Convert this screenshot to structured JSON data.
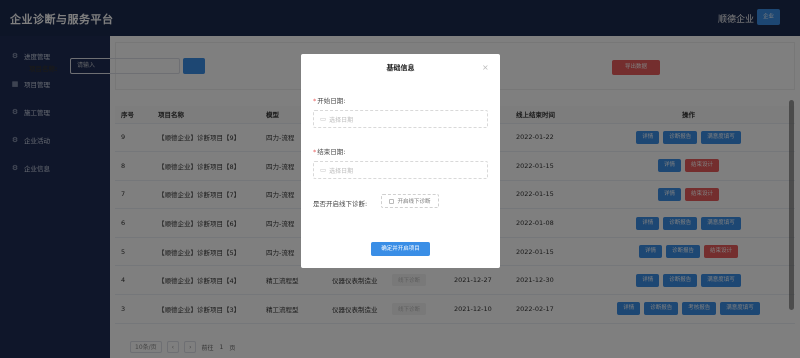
{
  "header": {
    "title": "企业诊断与服务平台",
    "company": "顺德企业",
    "role_badge": "企业"
  },
  "sidebar": {
    "items": [
      {
        "label": "进度管理",
        "icon": "gear-icon"
      },
      {
        "label": "项目管理",
        "icon": "grid-icon"
      },
      {
        "label": "施工管理",
        "icon": "gear-icon"
      },
      {
        "label": "企业活动",
        "icon": "gear-icon"
      },
      {
        "label": "企业信息",
        "icon": "gear-icon"
      }
    ]
  },
  "filter": {
    "label": "项目名称:",
    "placeholder": "请输入",
    "export_label": "导出数据"
  },
  "table": {
    "headers": [
      "序号",
      "项目名称",
      "模型",
      "",
      "",
      "",
      "线上结束时间",
      "操作"
    ],
    "rows": [
      {
        "no": "9",
        "name": "【顺德企业】诊断项目【9】",
        "model": "四力-流程",
        "industry": "",
        "status": "",
        "start": "",
        "end": "2022-01-22",
        "ops": [
          {
            "label": "详情",
            "color": "blue"
          },
          {
            "label": "诊断报告",
            "color": "blue"
          },
          {
            "label": "满意度填写",
            "color": "blue"
          }
        ]
      },
      {
        "no": "8",
        "name": "【顺德企业】诊断项目【8】",
        "model": "四力-流程",
        "industry": "",
        "status": "",
        "start": "",
        "end": "2022-01-15",
        "ops": [
          {
            "label": "详情",
            "color": "blue"
          },
          {
            "label": "结束设计",
            "color": "red"
          }
        ]
      },
      {
        "no": "7",
        "name": "【顺德企业】诊断项目【7】",
        "model": "四力-流程",
        "industry": "",
        "status": "",
        "start": "",
        "end": "2022-01-15",
        "ops": [
          {
            "label": "详情",
            "color": "blue"
          },
          {
            "label": "结束设计",
            "color": "red"
          }
        ]
      },
      {
        "no": "6",
        "name": "【顺德企业】诊断项目【6】",
        "model": "四力-流程",
        "industry": "",
        "status": "",
        "start": "",
        "end": "2022-01-08",
        "ops": [
          {
            "label": "详情",
            "color": "blue"
          },
          {
            "label": "诊断报告",
            "color": "blue"
          },
          {
            "label": "满意度填写",
            "color": "blue"
          }
        ]
      },
      {
        "no": "5",
        "name": "【顺德企业】诊断项目【5】",
        "model": "四力-流程",
        "industry": "",
        "status": "",
        "start": "",
        "end": "2022-01-15",
        "ops": [
          {
            "label": "详情",
            "color": "blue"
          },
          {
            "label": "诊断报告",
            "color": "blue"
          },
          {
            "label": "结束设计",
            "color": "red"
          }
        ]
      },
      {
        "no": "4",
        "name": "【顺德企业】诊断项目【4】",
        "model": "精工流程型",
        "industry": "仪器仪表制造业",
        "status": "线下诊断",
        "start": "2021-12-27",
        "end": "2021-12-30",
        "ops": [
          {
            "label": "详情",
            "color": "blue"
          },
          {
            "label": "诊断报告",
            "color": "blue"
          },
          {
            "label": "满意度填写",
            "color": "blue"
          }
        ]
      },
      {
        "no": "3",
        "name": "【顺德企业】诊断项目【3】",
        "model": "精工流程型",
        "industry": "仪器仪表制造业",
        "status": "线下诊断",
        "start": "2021-12-10",
        "end": "2022-02-17",
        "ops": [
          {
            "label": "详情",
            "color": "blue"
          },
          {
            "label": "诊断报告",
            "color": "blue"
          },
          {
            "label": "考核报告",
            "color": "blue"
          },
          {
            "label": "满意度填写",
            "color": "blue"
          }
        ]
      }
    ]
  },
  "pagination": {
    "page_size": "10条/页",
    "prev": "‹",
    "next": "›",
    "goto_label": "前往",
    "page": "1",
    "page_unit": "页"
  },
  "modal": {
    "title": "基础信息",
    "start_label": "开始日期:",
    "start_placeholder": "选择日期",
    "end_label": "结束日期:",
    "end_placeholder": "选择日期",
    "toggle_label": "是否开启线下诊断:",
    "toggle_value": "开启线下诊断",
    "submit_label": "确定并开启项目"
  },
  "colors": {
    "primary": "#3a8ee6",
    "danger": "#e95c5c",
    "header_bg": "#1b2a4e",
    "sidebar_bg": "#1f2d54"
  }
}
